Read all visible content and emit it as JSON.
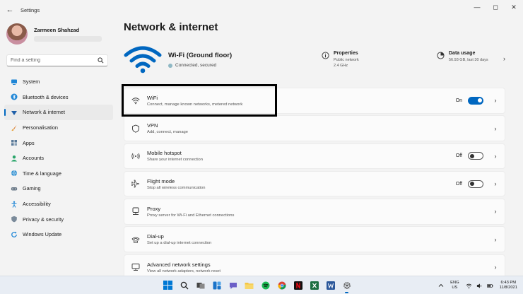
{
  "window": {
    "title": "Settings",
    "back_glyph": "←",
    "minimize_glyph": "—",
    "maximize_glyph": "◻",
    "close_glyph": "✕"
  },
  "profile": {
    "name": "Zarmeen Shahzad"
  },
  "search": {
    "placeholder": "Find a setting"
  },
  "nav": [
    {
      "label": "System",
      "icon": "monitor-icon",
      "active": false
    },
    {
      "label": "Bluetooth & devices",
      "icon": "bluetooth-icon",
      "active": false
    },
    {
      "label": "Network & internet",
      "icon": "network-icon",
      "active": true
    },
    {
      "label": "Personalisation",
      "icon": "brush-icon",
      "active": false
    },
    {
      "label": "Apps",
      "icon": "apps-icon",
      "active": false
    },
    {
      "label": "Accounts",
      "icon": "person-icon",
      "active": false
    },
    {
      "label": "Time & language",
      "icon": "globe-icon",
      "active": false
    },
    {
      "label": "Gaming",
      "icon": "gamepad-icon",
      "active": false
    },
    {
      "label": "Accessibility",
      "icon": "accessibility-icon",
      "active": false
    },
    {
      "label": "Privacy & security",
      "icon": "shield-icon",
      "active": false
    },
    {
      "label": "Windows Update",
      "icon": "update-icon",
      "active": false
    }
  ],
  "page": {
    "title": "Network & internet"
  },
  "hero": {
    "network_name": "Wi-Fi (Ground floor)",
    "status": "Connected, secured",
    "properties": {
      "title": "Properties",
      "line1": "Public network",
      "line2": "2.4 GHz"
    },
    "data_usage": {
      "title": "Data usage",
      "line1": "56.93 GB, last 30 days"
    },
    "chevron": "›"
  },
  "cards": [
    {
      "title": "WiFi",
      "desc": "Connect, manage known networks, metered network",
      "icon": "wifi-icon",
      "toggle": true,
      "toggle_on": true,
      "toggle_label": "On",
      "chevron": "›"
    },
    {
      "title": "VPN",
      "desc": "Add, connect, manage",
      "icon": "vpn-shield-icon",
      "toggle": false,
      "chevron": "›"
    },
    {
      "title": "Mobile hotspot",
      "desc": "Share your internet connection",
      "icon": "hotspot-icon",
      "toggle": true,
      "toggle_on": false,
      "toggle_label": "Off",
      "chevron": "›"
    },
    {
      "title": "Flight mode",
      "desc": "Stop all wireless communication",
      "icon": "airplane-icon",
      "toggle": true,
      "toggle_on": false,
      "toggle_label": "Off",
      "chevron": "›"
    },
    {
      "title": "Proxy",
      "desc": "Proxy server for Wi-Fi and Ethernet connections",
      "icon": "proxy-icon",
      "toggle": false,
      "chevron": "›"
    },
    {
      "title": "Dial-up",
      "desc": "Set up a dial-up internet connection",
      "icon": "dialup-icon",
      "toggle": false,
      "chevron": "›"
    },
    {
      "title": "Advanced network settings",
      "desc": "View all network adapters, network reset",
      "icon": "advanced-network-icon",
      "toggle": false,
      "chevron": "›"
    }
  ],
  "taskbar": {
    "apps": [
      "windows-start-icon",
      "search-icon",
      "task-view-icon",
      "widgets-icon",
      "chat-icon",
      "file-explorer-icon",
      "spotify-icon",
      "chrome-icon",
      "netflix-icon",
      "excel-icon",
      "word-icon",
      "settings-icon"
    ],
    "language": "ENG",
    "region": "US",
    "time": "6:43 PM",
    "date": "11/8/2021"
  },
  "colors": {
    "accent": "#0067c0",
    "highlight_border": "#000000"
  }
}
